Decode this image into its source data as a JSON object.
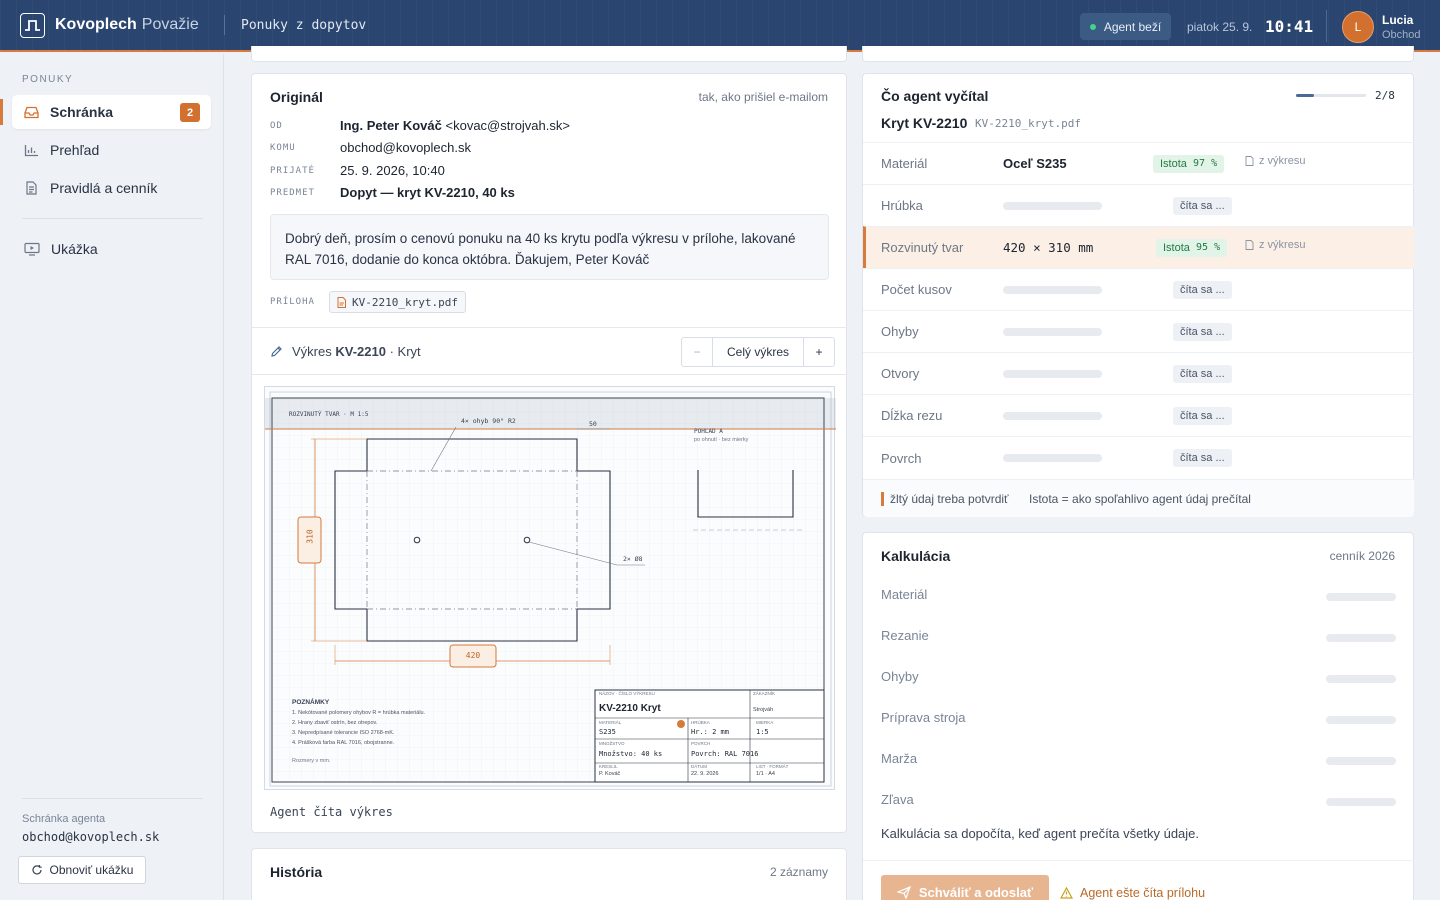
{
  "header": {
    "brand": "Kovoplech",
    "brand_suffix": "Považie",
    "title": "Ponuky z dopytov",
    "agent_status": "Agent beží",
    "date": "piatok 25. 9.",
    "time": "10:41",
    "user_initial": "L",
    "user_name": "Lucia",
    "user_role": "Obchod"
  },
  "sidebar": {
    "section": "PONUKY",
    "items": [
      {
        "label": "Schránka",
        "badge": "2",
        "icon": "inbox-icon"
      },
      {
        "label": "Prehľad",
        "icon": "chart-icon"
      },
      {
        "label": "Pravidlá a cenník",
        "icon": "document-icon"
      },
      {
        "label": "Ukážka",
        "icon": "monitor-play-icon"
      }
    ],
    "mailbox_label": "Schránka agenta",
    "mailbox_address": "obchod@kovoplech.sk",
    "reset_label": "Obnoviť ukážku"
  },
  "original": {
    "title": "Originál",
    "note": "tak, ako prišiel e-mailom",
    "from_key": "OD",
    "from_name": "Ing. Peter Kováč",
    "from_email": "<kovac@strojvah.sk>",
    "to_key": "KOMU",
    "to": "obchod@kovoplech.sk",
    "received_key": "PRIJATÉ",
    "received": "25. 9. 2026, 10:40",
    "subject_key": "PREDMET",
    "subject": "Dopyt — kryt KV-2210, 40 ks",
    "body": "Dobrý deň, prosím o cenovú ponuku na 40 ks krytu podľa výkresu v prílohe, lakované RAL 7016, dodanie do konca októbra. Ďakujem, Peter Kováč",
    "attachment_key": "PRÍLOHA",
    "attachment": "KV-2210_kryt.pdf"
  },
  "drawing": {
    "label_prefix": "Výkres",
    "code": "KV-2210",
    "label_suffix": "· Kryt",
    "zoom_out": "−",
    "zoom_fit": "Celý výkres",
    "zoom_in": "+",
    "status": "Agent číta výkres",
    "sheet": {
      "view_label": "ROZVINUTÝ TVAR · M 1:5",
      "bend_note": "4× ohyb 90° R2",
      "dim_flange": "50",
      "dim_height": "310",
      "dim_width": "420",
      "holes_note": "2× Ø8",
      "view_a": "POHĽAD A",
      "view_a_sub": "po ohnutí · bez mierky",
      "notes_title": "POZNÁMKY",
      "notes": [
        "1. Nekótované polomery ohybov R = hrúbka materiálu.",
        "2. Hrany zbaviť ostrín, bez otrepov.",
        "3. Nepredpísané tolerancie ISO 2768-mK.",
        "4. Prášková farba RAL 7016, obojstranne."
      ],
      "notes_units": "Rozmery v mm.",
      "tb_name_key": "NÁZOV · ČÍSLO VÝKRESU",
      "tb_name": "KV-2210 Kryt",
      "tb_customer_key": "ZÁKAZNÍK",
      "tb_customer": "Strojváh",
      "tb_material_key": "MATERIÁL",
      "tb_material": "S235",
      "tb_thickness_key": "HRÚBKA",
      "tb_thickness": "Hr.: 2 mm",
      "tb_scale_key": "MIERKA",
      "tb_scale": "1:5",
      "tb_qty_key": "MNOŽSTVO",
      "tb_qty": "Množstvo: 40 ks",
      "tb_surface_key": "POVRCH",
      "tb_surface": "Povrch: RAL 7016",
      "tb_drawn_key": "KRESLIL",
      "tb_drawn": "P. Kováč",
      "tb_date_key": "DÁTUM",
      "tb_date": "22. 9. 2026",
      "tb_sheet_key": "LIST · FORMÁT",
      "tb_sheet": "1/1 · A4"
    }
  },
  "history": {
    "title": "História",
    "count": "2 záznamy"
  },
  "extracted": {
    "title": "Čo agent vyčítal",
    "progress_text": "2/8",
    "progress": 0.25,
    "part": "Kryt KV-2210",
    "file": "KV-2210_kryt.pdf",
    "fields": [
      {
        "key": "Materiál",
        "value": "Oceľ S235",
        "status": "Istota",
        "confidence": "97 %",
        "source": "z výkresu"
      },
      {
        "key": "Hrúbka",
        "status": "číta sa ..."
      },
      {
        "key": "Rozvinutý tvar",
        "value": "420 × 310 mm",
        "status": "Istota",
        "confidence": "95 %",
        "source": "z výkresu"
      },
      {
        "key": "Počet kusov",
        "status": "číta sa ..."
      },
      {
        "key": "Ohyby",
        "status": "číta sa ..."
      },
      {
        "key": "Otvory",
        "status": "číta sa ..."
      },
      {
        "key": "Dĺžka rezu",
        "status": "číta sa ..."
      },
      {
        "key": "Povrch",
        "status": "číta sa ..."
      }
    ],
    "legend_warn": "žltý údaj treba potvrdiť",
    "legend_conf": "Istota = ako spoľahlivo agent údaj prečítal"
  },
  "calculation": {
    "title": "Kalkulácia",
    "pricelist": "cenník 2026",
    "rows": [
      "Materiál",
      "Rezanie",
      "Ohyby",
      "Príprava stroja",
      "Marža",
      "Zľava"
    ],
    "note": "Kalkulácia sa dopočíta, keď agent prečíta všetky údaje.",
    "approve_label": "Schváliť a odoslať",
    "warning": "Agent ešte číta prílohu"
  },
  "colors": {
    "header_bg": "#2a4670",
    "accent": "#d67a3e",
    "ok": "#247a45"
  }
}
